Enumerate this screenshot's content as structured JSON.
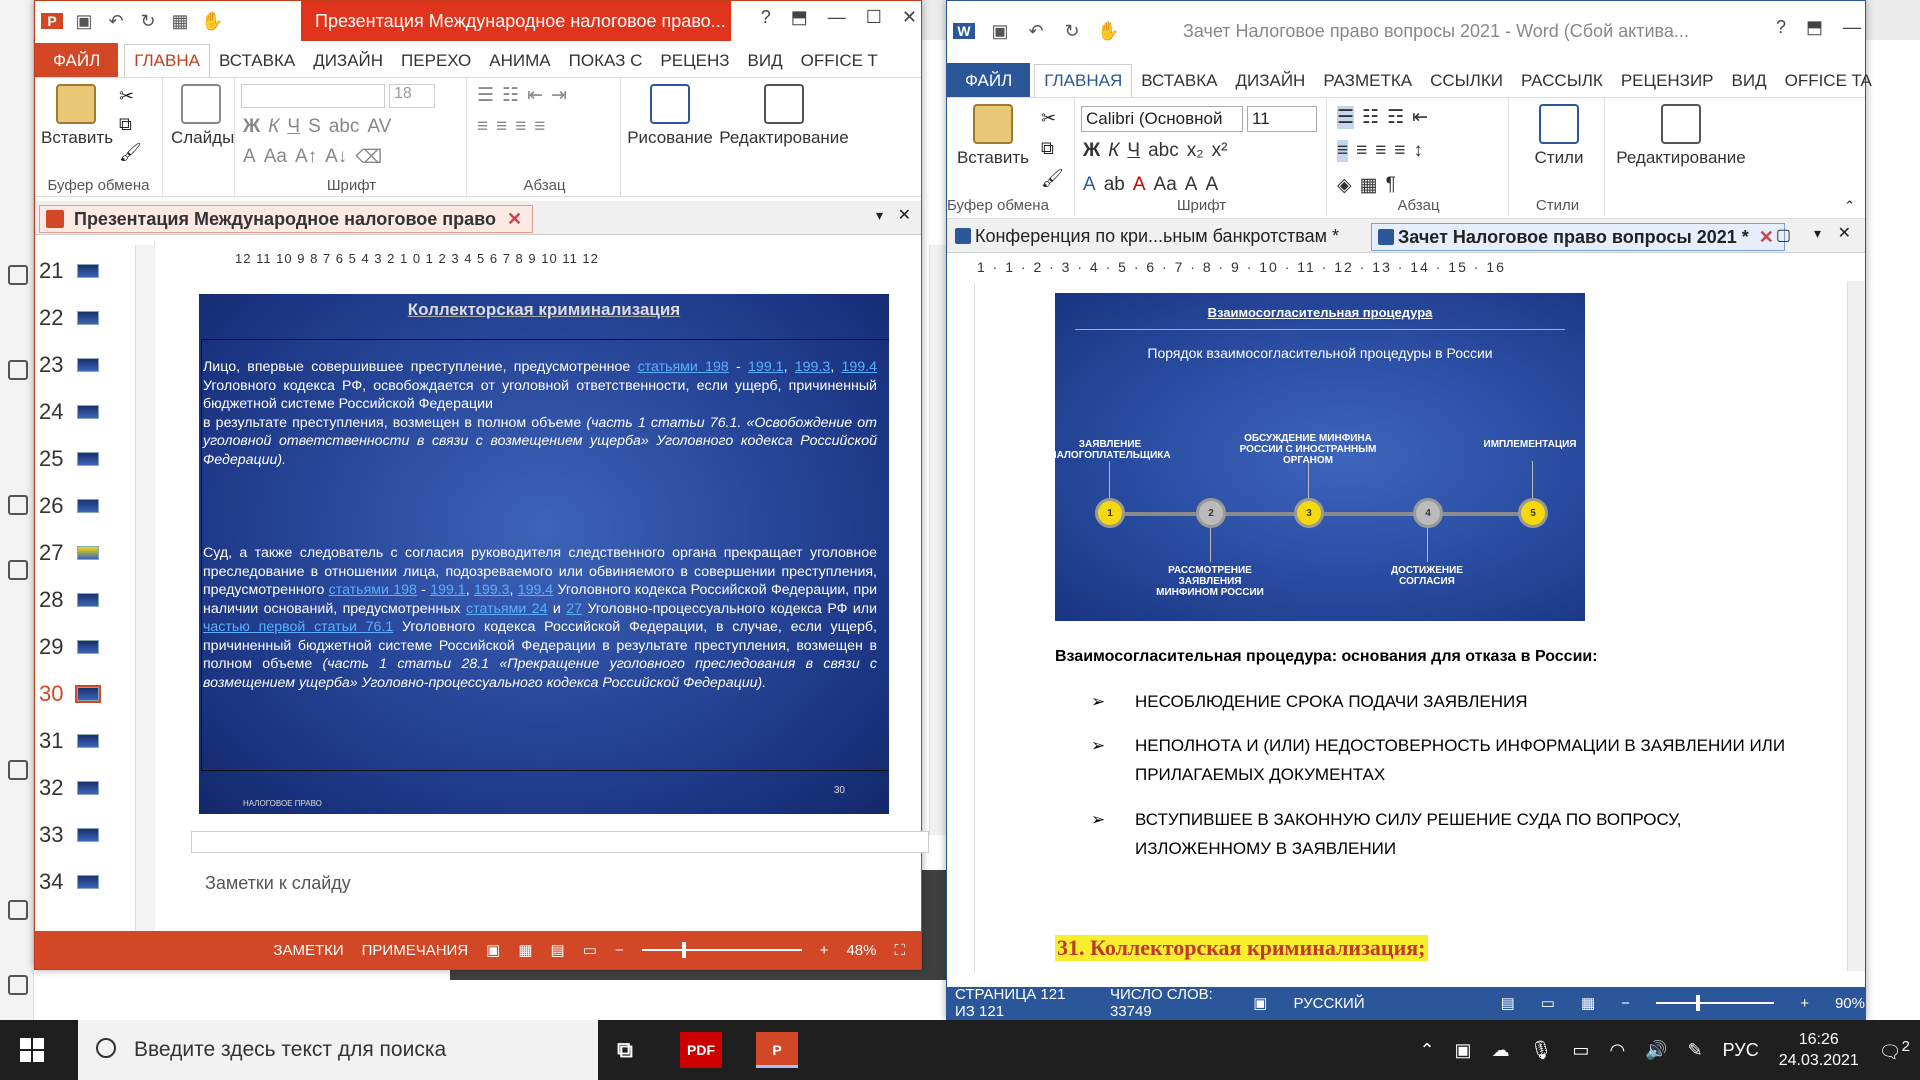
{
  "powerpoint": {
    "window_title": "Презентация Международное налоговое право...",
    "help": "?",
    "tabs": [
      "ФАЙЛ",
      "ГЛАВНА",
      "ВСТАВКА",
      "ДИЗАЙН",
      "ПЕРЕХО",
      "АНИМА",
      "ПОКАЗ С",
      "РЕЦЕНЗ",
      "ВИД",
      "OFFICE T"
    ],
    "ribbon": {
      "paste": "Вставить",
      "slides": "Слайды",
      "font_size": "18",
      "drawing": "Рисование",
      "editing": "Редактирование",
      "groups": [
        "Буфер обмена",
        "Шрифт",
        "Абзац"
      ]
    },
    "doc_tab": "Презентация Международное налоговое право",
    "thumbnails": [
      "21",
      "22",
      "23",
      "24",
      "25",
      "26",
      "27",
      "28",
      "29",
      "30",
      "31",
      "32",
      "33",
      "34"
    ],
    "selected_slide": "30",
    "ruler": "12 11 10 9 8 7 6 5 4 3 2 1 0 1 2 3 4 5 6 7 8 9 10 11 12",
    "slide": {
      "title": "Коллекторская криминализация",
      "p1_a": "Лицо, впервые совершившее преступление, предусмотренное ",
      "p1_l1": "статьями 198",
      "p1_b": " - ",
      "p1_l2": "199.1",
      "p1_c": ", ",
      "p1_l3": "199.3",
      "p1_d": ", ",
      "p1_l4": "199.4",
      "p1_e": " Уголовного кодекса РФ, освобождается от уголовной ответственности, если ущерб, причиненный бюджетной системе Российской Федерации",
      "p1_f": "в результате преступления, возмещен в полном объеме ",
      "p1_g": "(часть 1 статьи 76.1. «Освобождение от уголовной ответственности в связи с возмещением ущерба» Уголовного кодекса Российской Федерации).",
      "p2_a": "Суд, а также следователь с согласия руководителя следственного органа прекращает уголовное преследование в отношении лица, подозреваемого или обвиняемого в совершении преступления, предусмотренного ",
      "p2_l1": "статьями 198",
      "p2_b": " - ",
      "p2_l2": "199.1",
      "p2_c": ", ",
      "p2_l3": "199.3",
      "p2_d": ", ",
      "p2_l4": "199.4",
      "p2_e": " Уголовного кодекса Российской Федерации, при наличии оснований, предусмотренных ",
      "p2_l5": "статьями 24",
      "p2_f": " и ",
      "p2_l6": "27",
      "p2_g": " Уголовно-процессуального кодекса РФ или ",
      "p2_l7": "частью первой статьи 76.1",
      "p2_h": " Уголовного кодекса Российской Федерации, в случае, если ущерб, причиненный бюджетной системе Российской Федерации в результате преступления, возмещен в полном объеме ",
      "p2_i": "(часть 1 статьи 28.1 «Прекращение уголовного преследования в связи с возмещением ущерба» Уголовно-процессуального кодекса Российской Федерации).",
      "footer": "НАЛОГОВОЕ ПРАВО",
      "number": "30"
    },
    "notes_placeholder": "Заметки к слайду",
    "status": {
      "notes": "ЗАМЕТКИ",
      "comments": "ПРИМЕЧАНИЯ",
      "zoom": "48%"
    }
  },
  "word": {
    "window_title": "Зачет Налоговое право вопросы 2021 - Word (Сбой актива...",
    "help": "?",
    "tabs": [
      "ФАЙЛ",
      "ГЛАВНАЯ",
      "ВСТАВКА",
      "ДИЗАЙН",
      "РАЗМЕТКА",
      "ССЫЛКИ",
      "РАССЫЛК",
      "РЕЦЕНЗИР",
      "ВИД",
      "OFFICE TA"
    ],
    "ribbon": {
      "paste": "Вставить",
      "font": "Calibri (Основной",
      "font_size": "11",
      "styles": "Стили",
      "editing": "Редактирование",
      "groups": [
        "Буфер обмена",
        "Шрифт",
        "Абзац",
        "Стили"
      ]
    },
    "doc_tabs": [
      "Конференция по кри...ьным банкротствам *",
      "Зачет Налоговое право вопросы 2021 *"
    ],
    "ruler": "1 · 1 · 2 · 3 · 4 · 5 · 6 · 7 · 8 · 9 · 10 · 11 · 12 · 13 · 14 · 15 · 16",
    "diagram": {
      "title": "Взаимосогласительная процедура",
      "subtitle": "Порядок взаимосогласительной процедуры в России",
      "steps": [
        "1",
        "2",
        "3",
        "4",
        "5"
      ],
      "top_labels": [
        "ЗАЯВЛЕНИЕ НАЛОГОПЛАТЕЛЬЩИКА",
        "ОБСУЖДЕНИЕ МИНФИНА РОССИИ С ИНОСТРАННЫМ ОРГАНОМ",
        "ИМПЛЕМЕНТАЦИЯ"
      ],
      "bottom_labels": [
        "РАССМОТРЕНИЕ ЗАЯВЛЕНИЯ МИНФИНОМ РОССИИ",
        "ДОСТИЖЕНИЕ СОГЛАСИЯ"
      ]
    },
    "heading": "Взаимосогласительная процедура: основания для отказа в России:",
    "bullets": [
      "НЕСОБЛЮДЕНИЕ СРОКА ПОДАЧИ ЗАЯВЛЕНИЯ",
      "НЕПОЛНОТА И (ИЛИ) НЕДОСТОВЕРНОСТЬ ИНФОРМАЦИИ В ЗАЯВЛЕНИИ ИЛИ ПРИЛАГАЕМЫХ ДОКУМЕНТАХ",
      "ВСТУПИВШЕЕ В ЗАКОННУЮ СИЛУ РЕШЕНИЕ СУДА ПО ВОПРОСУ, ИЗЛОЖЕННОМУ В ЗАЯВЛЕНИИ"
    ],
    "section_heading": "31. Коллекторская криминализация;",
    "status": {
      "page": "СТРАНИЦА 121 ИЗ 121",
      "words": "ЧИСЛО СЛОВ: 33749",
      "lang": "РУССКИЙ",
      "zoom": "90%"
    }
  },
  "taskbar": {
    "search_placeholder": "Введите здесь текст для поиска",
    "pdf_label": "PDF",
    "lang": "РУС",
    "time": "16:26",
    "date": "24.03.2021",
    "notifications": "2"
  },
  "colors": {
    "ppt_accent": "#d24726",
    "word_accent": "#2b579a",
    "highlight": "#f7ef2e"
  }
}
